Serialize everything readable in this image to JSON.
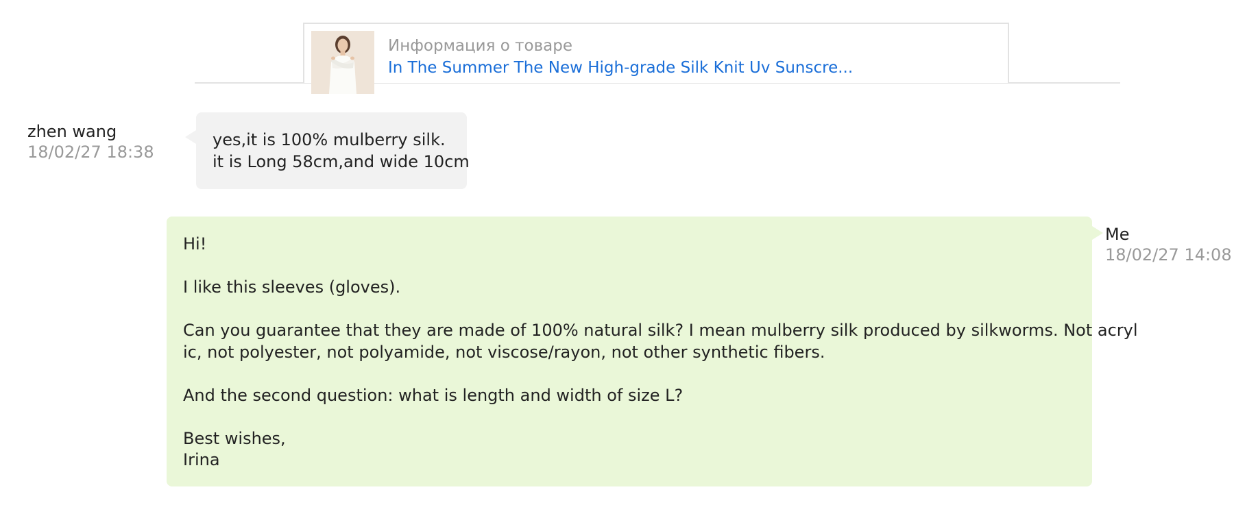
{
  "product": {
    "caption": "Информация о товаре",
    "title": "In The Summer The New High-grade Silk Knit Uv Sunscre...",
    "thumbnail_icon": "product-photo"
  },
  "messages": [
    {
      "sender": "zhen wang",
      "time": "18/02/27 18:38",
      "lines": [
        "yes,it is 100%  mulberry silk.",
        "it is Long 58cm,and wide 10cm"
      ]
    },
    {
      "sender": "Me",
      "time": "18/02/27 14:08",
      "greeting": "Hi!",
      "p1": "I like this sleeves (gloves).",
      "p2_line1": "Can you guarantee that they are made of 100% natural silk? I mean mulberry silk produced by silkworms. Not acryl",
      "p2_line2": "ic, not polyester, not polyamide, not viscose/rayon, not other synthetic fibers.",
      "p3": "And the second question: what is length and width of size L?",
      "closing": "Best wishes,",
      "signature": "Irina"
    }
  ],
  "colors": {
    "incoming_bubble": "#f2f2f2",
    "outgoing_bubble": "#eaf7d8",
    "link": "#1a6ed8",
    "muted_text": "#999999"
  }
}
